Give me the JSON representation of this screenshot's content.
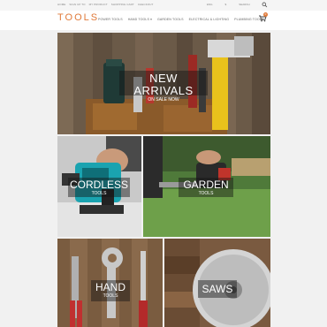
{
  "topbar": {
    "links": [
      "Home",
      "Sign up to",
      "My product",
      "Shopping cart",
      "Checkout"
    ],
    "language": "Eng",
    "currency": "$",
    "search_label": "Search"
  },
  "header": {
    "logo": "TOOLS",
    "nav": [
      "Power Tools",
      "Hand Tools ▾",
      "Garden Tools",
      "Electrical & Lighting",
      "Plumbing Tools"
    ],
    "cart_count": "0"
  },
  "banners": {
    "hero": {
      "title": "NEW ARRIVALS",
      "subtitle": "ON SALE NOW"
    },
    "cordless": {
      "title": "CORDLESS",
      "subtitle": "TOOLS"
    },
    "garden": {
      "title": "GARDEN",
      "subtitle": "TOOLS"
    },
    "hand": {
      "title": "HAND",
      "subtitle": "TOOLS"
    },
    "saws": {
      "title": "SAWS"
    }
  },
  "colors": {
    "accent": "#e07a3a",
    "background": "#f1f1f1"
  }
}
